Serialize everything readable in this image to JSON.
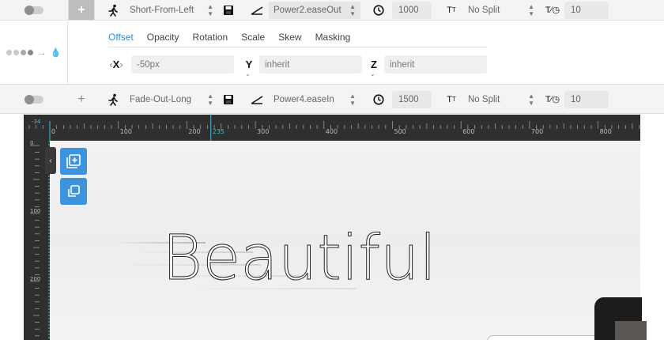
{
  "rows": [
    {
      "animation": "Short-From-Left",
      "ease": "Power2.easeOut",
      "duration": "1000",
      "split": "No Split",
      "delay": "10",
      "add_symbol": "+"
    },
    {
      "animation": "Fade-Out-Long",
      "ease": "Power4.easeIn",
      "duration": "1500",
      "split": "No Split",
      "delay": "10",
      "add_symbol": "+"
    }
  ],
  "detail": {
    "tabs": [
      "Offset",
      "Opacity",
      "Rotation",
      "Scale",
      "Skew",
      "Masking"
    ],
    "active_tab": "Offset",
    "x_label": "X",
    "x_value": "-50px",
    "y_label": "Y",
    "y_value": "inherit",
    "z_label": "Z",
    "z_value": "inherit"
  },
  "ruler": {
    "h_labels": [
      "0",
      "100",
      "200",
      "235",
      "300",
      "400",
      "500",
      "600",
      "700",
      "800"
    ],
    "v_labels": [
      "0",
      "100",
      "200"
    ],
    "corner_label": "-34",
    "marker_value": "235"
  },
  "canvas": {
    "headline": "Beautiful"
  },
  "colors": {
    "accent": "#3d93dc",
    "ruler_bg": "#2f2f2f",
    "marker": "#3fc3d6"
  }
}
